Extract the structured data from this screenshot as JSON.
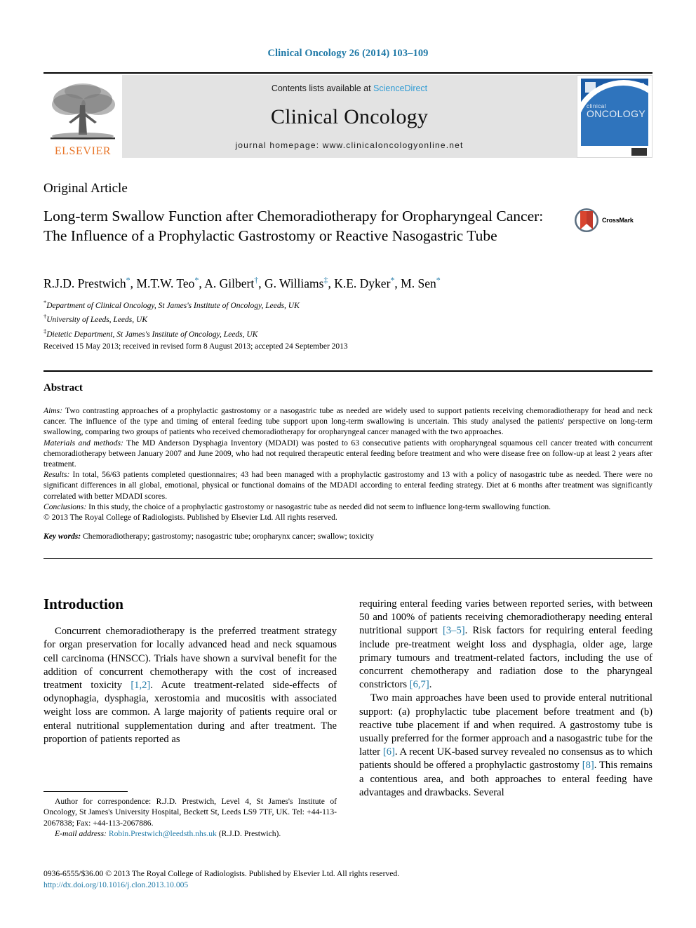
{
  "running_head": "Clinical Oncology 26 (2014) 103–109",
  "masthead": {
    "publisher_logo_label": "ELSEVIER",
    "contents_prefix": "Contents lists available at ",
    "contents_link": "ScienceDirect",
    "journal_name": "Clinical Oncology",
    "homepage_label": "journal homepage: www.clinicaloncologyonline.net",
    "cover": {
      "line1": "clinical",
      "line2": "ONCOLOGY"
    }
  },
  "article": {
    "type": "Original Article",
    "title": "Long-term Swallow Function after Chemoradiotherapy for Oropharyngeal Cancer: The Influence of a Prophylactic Gastrostomy or Reactive Nasogastric Tube",
    "crossmark_label": "CrossMark",
    "authors": [
      {
        "name": "R.J.D. Prestwich",
        "marker": "*"
      },
      {
        "name": "M.T.W. Teo",
        "marker": "*"
      },
      {
        "name": "A. Gilbert",
        "marker": "†"
      },
      {
        "name": "G. Williams",
        "marker": "‡"
      },
      {
        "name": "K.E. Dyker",
        "marker": "*"
      },
      {
        "name": "M. Sen",
        "marker": "*"
      }
    ],
    "affiliations": [
      {
        "marker": "*",
        "text": "Department of Clinical Oncology, St James's Institute of Oncology, Leeds, UK"
      },
      {
        "marker": "†",
        "text": "University of Leeds, Leeds, UK"
      },
      {
        "marker": "‡",
        "text": "Dietetic Department, St James's Institute of Oncology, Leeds, UK"
      }
    ],
    "history": "Received 15 May 2013; received in revised form 8 August 2013; accepted 24 September 2013"
  },
  "abstract": {
    "heading": "Abstract",
    "sections": [
      {
        "label": "Aims:",
        "text": " Two contrasting approaches of a prophylactic gastrostomy or a nasogastric tube as needed are widely used to support patients receiving chemoradiotherapy for head and neck cancer. The influence of the type and timing of enteral feeding tube support upon long-term swallowing is uncertain. This study analysed the patients' perspective on long-term swallowing, comparing two groups of patients who received chemoradiotherapy for oropharyngeal cancer managed with the two approaches."
      },
      {
        "label": "Materials and methods:",
        "text": " The MD Anderson Dysphagia Inventory (MDADI) was posted to 63 consecutive patients with oropharyngeal squamous cell cancer treated with concurrent chemoradiotherapy between January 2007 and June 2009, who had not required therapeutic enteral feeding before treatment and who were disease free on follow-up at least 2 years after treatment."
      },
      {
        "label": "Results:",
        "text": " In total, 56/63 patients completed questionnaires; 43 had been managed with a prophylactic gastrostomy and 13 with a policy of nasogastric tube as needed. There were no significant differences in all global, emotional, physical or functional domains of the MDADI according to enteral feeding strategy. Diet at 6 months after treatment was significantly correlated with better MDADI scores."
      },
      {
        "label": "Conclusions:",
        "text": " In this study, the choice of a prophylactic gastrostomy or nasogastric tube as needed did not seem to influence long-term swallowing function."
      }
    ],
    "copyright": "© 2013 The Royal College of Radiologists. Published by Elsevier Ltd. All rights reserved.",
    "keywords_label": "Key words:",
    "keywords": " Chemoradiotherapy; gastrostomy; nasogastric tube; oropharynx cancer; swallow; toxicity"
  },
  "body": {
    "introduction_heading": "Introduction",
    "left_paragraphs": [
      {
        "parts": [
          {
            "t": "Concurrent chemoradiotherapy is the preferred treatment strategy for organ preservation for locally advanced head and neck squamous cell carcinoma (HNSCC). Trials have shown a survival benefit for the addition of concurrent chemotherapy with the cost of increased treatment toxicity "
          },
          {
            "t": "[1,2]",
            "ref": true
          },
          {
            "t": ". Acute treatment-related side-effects of odynophagia, dysphagia, xerostomia and mucositis with associated weight loss are common. A large majority of patients require oral or enteral nutritional supplementation during and after treatment. The proportion of patients reported as"
          }
        ]
      }
    ],
    "right_paragraphs": [
      {
        "indent": false,
        "parts": [
          {
            "t": "requiring enteral feeding varies between reported series, with between 50 and 100% of patients receiving chemoradiotherapy needing enteral nutritional support "
          },
          {
            "t": "[3–5]",
            "ref": true
          },
          {
            "t": ". Risk factors for requiring enteral feeding include pre-treatment weight loss and dysphagia, older age, large primary tumours and treatment-related factors, including the use of concurrent chemotherapy and radiation dose to the pharyngeal constrictors "
          },
          {
            "t": "[6,7]",
            "ref": true
          },
          {
            "t": "."
          }
        ]
      },
      {
        "indent": true,
        "parts": [
          {
            "t": "Two main approaches have been used to provide enteral nutritional support: (a) prophylactic tube placement before treatment and (b) reactive tube placement if and when required. A gastrostomy tube is usually preferred for the former approach and a nasogastric tube for the latter "
          },
          {
            "t": "[6]",
            "ref": true
          },
          {
            "t": ". A recent UK-based survey revealed no consensus as to which patients should be offered a prophylactic gastrostomy "
          },
          {
            "t": "[8]",
            "ref": true
          },
          {
            "t": ". This remains a contentious area, and both approaches to enteral feeding have advantages and drawbacks. Several"
          }
        ]
      }
    ]
  },
  "footnote": {
    "correspondence": "Author for correspondence: R.J.D. Prestwich, Level 4, St James's Institute of Oncology, St James's University Hospital, Beckett St, Leeds LS9 7TF, UK. Tel: +44-113-2067838; Fax: +44-113-2067886.",
    "email_label": "E-mail address:",
    "email": "Robin.Prestwich@leedsth.nhs.uk",
    "email_suffix": " (R.J.D. Prestwich)."
  },
  "page_footer": {
    "issn_line": "0936-6555/$36.00 © 2013 The Royal College of Radiologists. Published by Elsevier Ltd. All rights reserved.",
    "doi": "http://dx.doi.org/10.1016/j.clon.2013.10.005"
  },
  "colors": {
    "link": "#1f79a7",
    "elsevier_orange": "#e8762a",
    "masthead_gray": "#e3e3e3",
    "cover_blue": "#1b5ba6"
  }
}
